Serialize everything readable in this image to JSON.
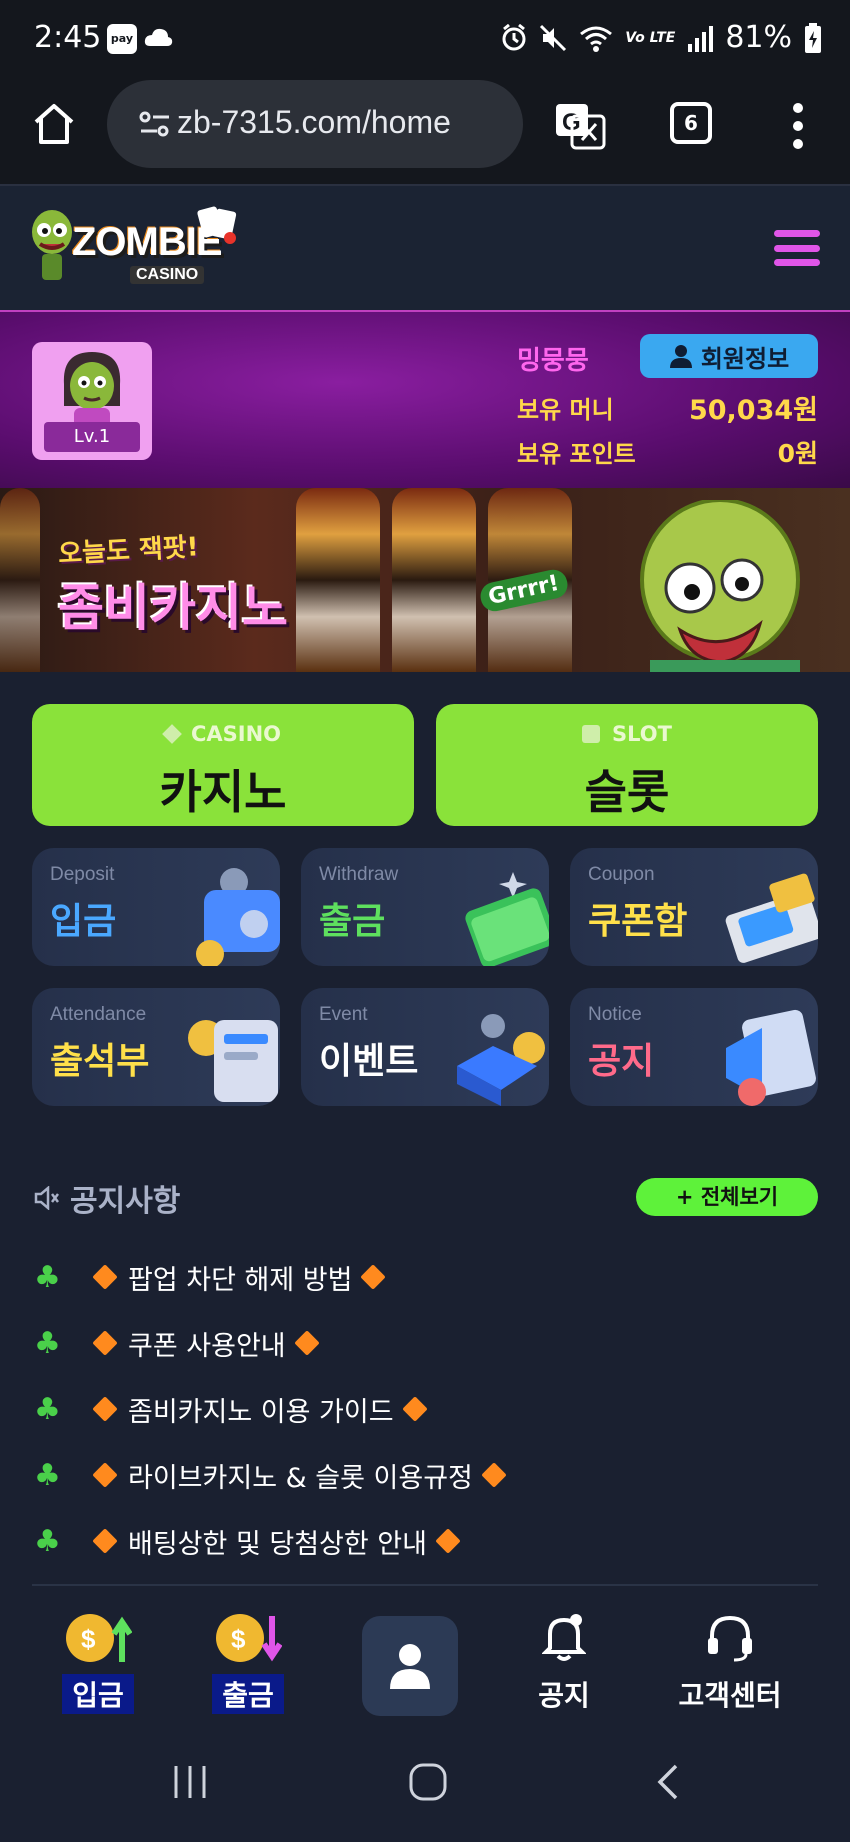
{
  "status_bar": {
    "time": "2:45",
    "pay_label": "pay",
    "battery": "81%",
    "network": "Vo LTE"
  },
  "browser": {
    "url": "zb-7315.com/home",
    "tab_count": "6"
  },
  "site": {
    "logo_text": "ZOMBIE",
    "logo_sub": "CASINO"
  },
  "user": {
    "level": "Lv.1",
    "username": "밍뭉뭉",
    "member_button": "회원정보",
    "money_label": "보유 머니",
    "money_value": "50,034원",
    "point_label": "보유 포인트",
    "point_value": "0원"
  },
  "banner": {
    "line1": "오늘도 잭팟!",
    "line2": "좀비카지노",
    "speech": "Grrrr!"
  },
  "games": {
    "casino_sub": "CASINO",
    "casino_main": "카지노",
    "slot_sub": "SLOT",
    "slot_main": "슬롯"
  },
  "tiles": [
    {
      "en": "Deposit",
      "ko": "입금",
      "color": "#4aa8ff"
    },
    {
      "en": "Withdraw",
      "ko": "출금",
      "color": "#5ee05e"
    },
    {
      "en": "Coupon",
      "ko": "쿠폰함",
      "color": "#ffe04a"
    },
    {
      "en": "Attendance",
      "ko": "출석부",
      "color": "#ffe04a"
    },
    {
      "en": "Event",
      "ko": "이벤트",
      "color": "#ffffff"
    },
    {
      "en": "Notice",
      "ko": "공지",
      "color": "#ff6a8a"
    }
  ],
  "notices": {
    "title": "공지사항",
    "view_all": "+ 전체보기",
    "items": [
      "팝업 차단 해제 방법",
      "쿠폰 사용안내",
      "좀비카지노 이용 가이드",
      "라이브카지노 & 슬롯 이용규정",
      "배팅상한 및 당첨상한 안내"
    ]
  },
  "bottom_nav": {
    "deposit": "입금",
    "withdraw": "출금",
    "notice": "공지",
    "support": "고객센터"
  },
  "colors": {
    "accent_green": "#8ae23a",
    "accent_purple": "#e055e8",
    "bg": "#1a2030"
  }
}
